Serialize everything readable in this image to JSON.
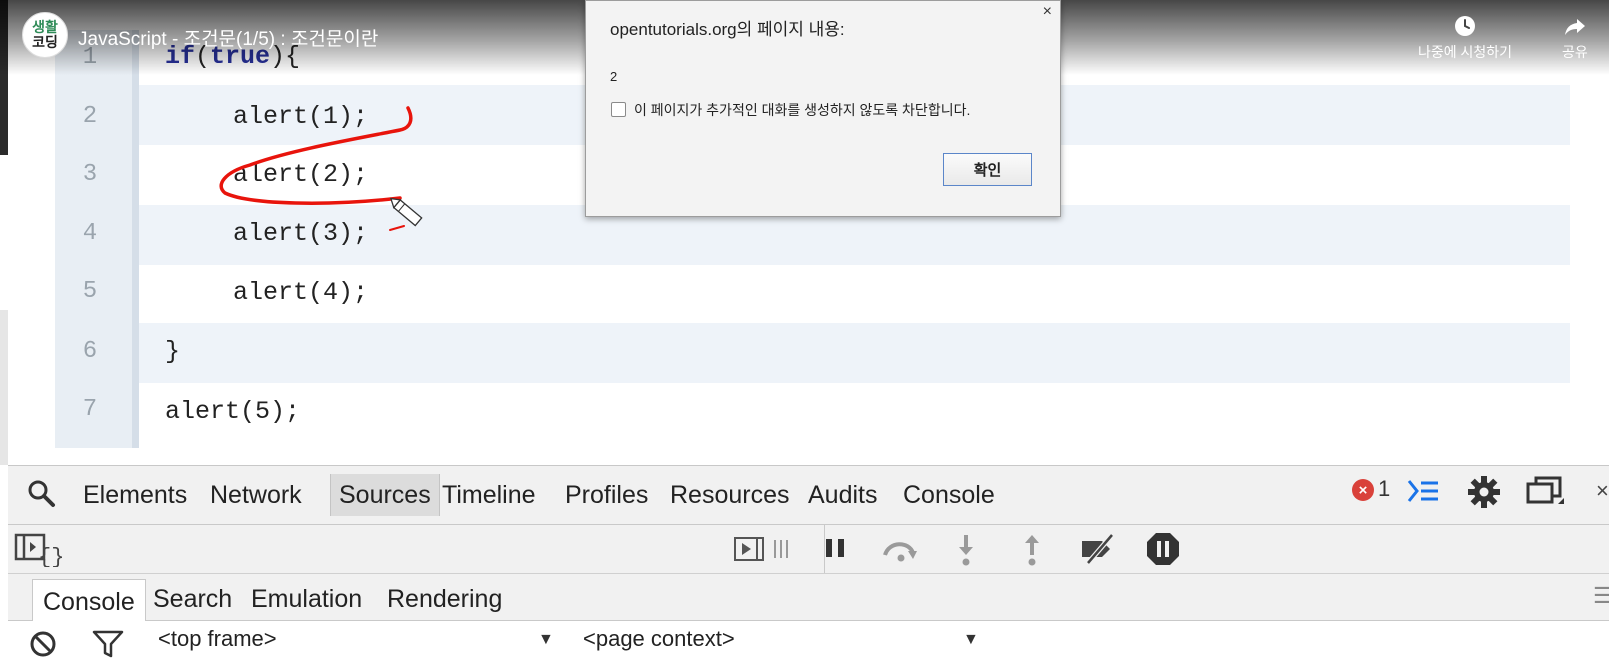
{
  "video": {
    "channel_logo_text_top": "생활",
    "channel_logo_text_bottom": "코딩",
    "title": "JavaScript - 조건문(1/5) : 조건문이란",
    "watch_later_label": "나중에 시청하기",
    "share_label": "공유"
  },
  "code": {
    "lines": [
      {
        "num": "1",
        "text": "if(true){"
      },
      {
        "num": "2",
        "text": "alert(1);"
      },
      {
        "num": "3",
        "text": "alert(2);"
      },
      {
        "num": "4",
        "text": "alert(3);"
      },
      {
        "num": "5",
        "text": "alert(4);"
      },
      {
        "num": "6",
        "text": "}"
      },
      {
        "num": "7",
        "text": "alert(5);"
      }
    ],
    "line1_keyword_if": "if",
    "line1_paren_open": "(",
    "line1_keyword_true": "true",
    "line1_rest": "){",
    "annotation_color": "#e8140c"
  },
  "dialog": {
    "title": "opentutorials.org의 페이지 내용:",
    "close_glyph": "×",
    "message": "2",
    "checkbox_label": "이 페이지가 추가적인 대화를 생성하지 않도록 차단합니다.",
    "ok_label": "확인"
  },
  "devtools": {
    "tabs": [
      "Elements",
      "Network",
      "Sources",
      "Timeline",
      "Profiles",
      "Resources",
      "Audits",
      "Console"
    ],
    "active_tab": "Sources",
    "error_count": "1",
    "drawer_tabs": [
      "Console",
      "Search",
      "Emulation",
      "Rendering"
    ],
    "active_drawer_tab": "Console",
    "frame_selector": "<top frame>",
    "context_selector": "<page context>",
    "error_color": "#d9413a",
    "accent_color": "#1a73e8"
  }
}
